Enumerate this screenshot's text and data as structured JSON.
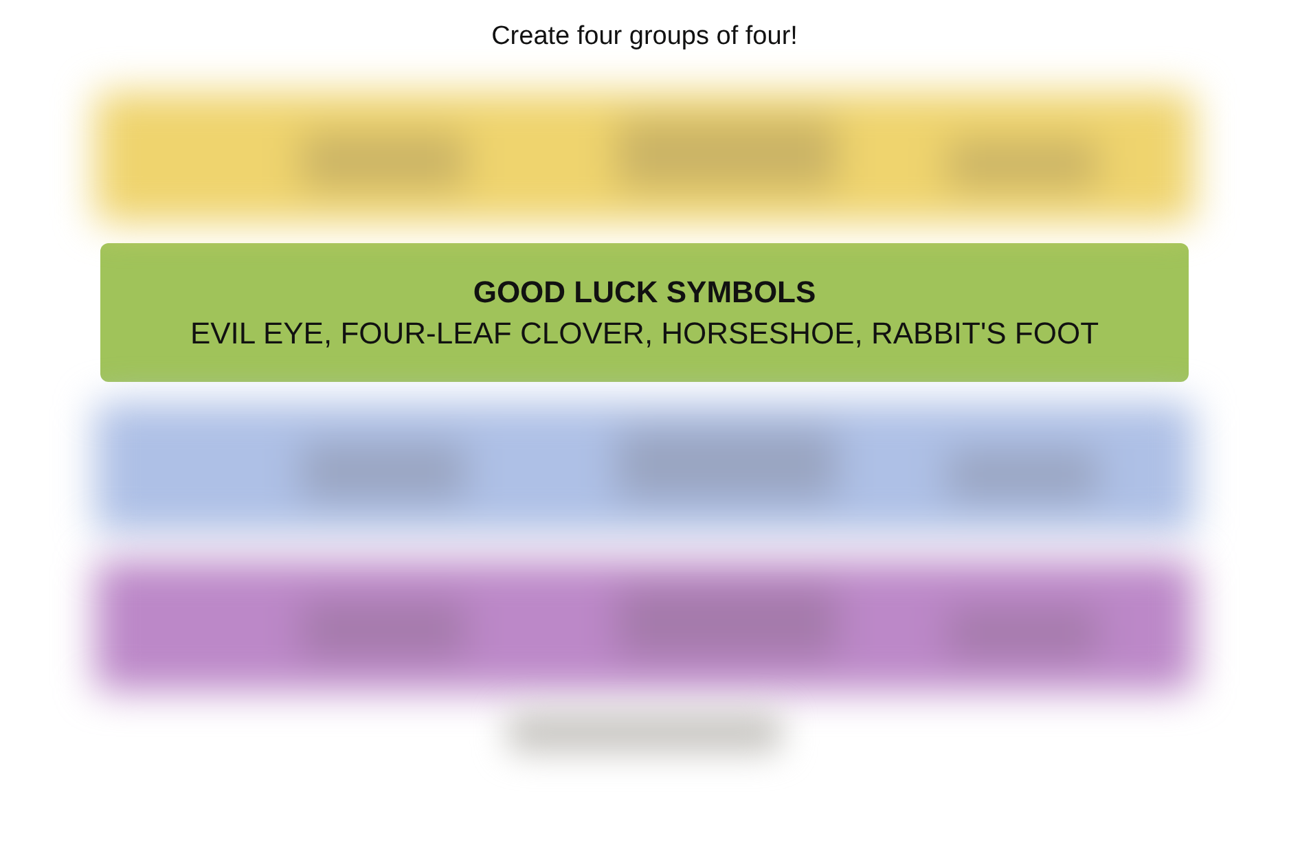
{
  "title": "Create four groups of four!",
  "groups": [
    {
      "kind": "hidden",
      "color": "#efd46e"
    },
    {
      "kind": "solved",
      "color": "#a0c35a",
      "name": "GOOD LUCK SYMBOLS",
      "members": "EVIL EYE, FOUR-LEAF CLOVER, HORSESHOE, RABBIT'S FOOT"
    },
    {
      "kind": "hidden",
      "color": "#aec0e6"
    },
    {
      "kind": "hidden",
      "color": "#bc88c8"
    }
  ]
}
